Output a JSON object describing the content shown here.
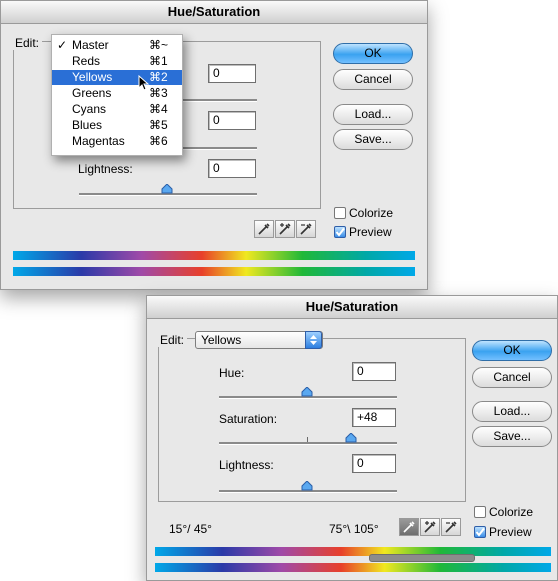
{
  "dialog1": {
    "title": "Hue/Saturation",
    "edit_label": "Edit:",
    "menu": {
      "items": [
        {
          "label": "Master",
          "shortcut": "⌘~",
          "checked": true
        },
        {
          "label": "Reds",
          "shortcut": "⌘1"
        },
        {
          "label": "Yellows",
          "shortcut": "⌘2",
          "selected": true
        },
        {
          "label": "Greens",
          "shortcut": "⌘3"
        },
        {
          "label": "Cyans",
          "shortcut": "⌘4"
        },
        {
          "label": "Blues",
          "shortcut": "⌘5"
        },
        {
          "label": "Magentas",
          "shortcut": "⌘6"
        }
      ],
      "check_mark": "✓"
    },
    "hue_value": "0",
    "saturation_value": "0",
    "lightness_label": "Lightness:",
    "lightness_value": "0",
    "buttons": {
      "ok": "OK",
      "cancel": "Cancel",
      "load": "Load...",
      "save": "Save..."
    },
    "colorize": {
      "label": "Colorize",
      "checked": false
    },
    "preview": {
      "label": "Preview",
      "checked": true
    },
    "eyedroppers": [
      "eyedropper-icon",
      "eyedropper-plus-icon",
      "eyedropper-minus-icon"
    ]
  },
  "dialog2": {
    "title": "Hue/Saturation",
    "edit_label": "Edit:",
    "edit_selected": "Yellows",
    "hue_label": "Hue:",
    "hue_value": "0",
    "saturation_label": "Saturation:",
    "saturation_value": "+48",
    "lightness_label": "Lightness:",
    "lightness_value": "0",
    "range_left": "15°/ 45°",
    "range_right": "75°\\ 105°",
    "buttons": {
      "ok": "OK",
      "cancel": "Cancel",
      "load": "Load...",
      "save": "Save..."
    },
    "colorize": {
      "label": "Colorize",
      "checked": false
    },
    "preview": {
      "label": "Preview",
      "checked": true
    },
    "eyedroppers": [
      "eyedropper-icon",
      "eyedropper-plus-icon",
      "eyedropper-minus-icon"
    ],
    "saturation_level": 0.74
  },
  "colors": {
    "accent": "#2a6fd6",
    "default_button": "#3aa2f0",
    "dialog_bg": "#e8e8e8"
  }
}
